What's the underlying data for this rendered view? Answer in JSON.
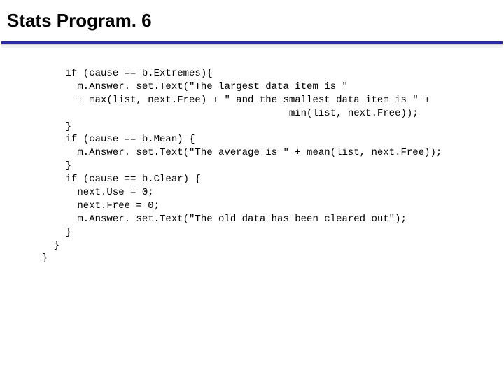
{
  "title": "Stats Program. 6",
  "code_lines": [
    "    if (cause == b.Extremes){",
    "      m.Answer. set.Text(\"The largest data item is \"",
    "      + max(list, next.Free) + \" and the smallest data item is \" +",
    "                                          min(list, next.Free));",
    "    }",
    "    if (cause == b.Mean) {",
    "      m.Answer. set.Text(\"The average is \" + mean(list, next.Free));",
    "    }",
    "    if (cause == b.Clear) {",
    "      next.Use = 0;",
    "      next.Free = 0;",
    "      m.Answer. set.Text(\"The old data has been cleared out\");",
    "    }",
    "  }",
    "}"
  ]
}
